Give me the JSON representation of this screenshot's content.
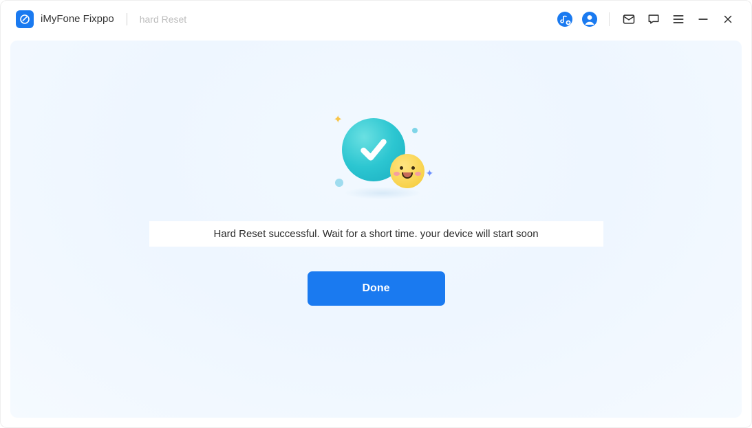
{
  "app": {
    "title": "iMyFone Fixppo",
    "breadcrumb": "hard Reset"
  },
  "main": {
    "message": "Hard Reset successful. Wait for a short time. your device will start soon",
    "done_label": "Done"
  },
  "icons": {
    "music": "music-note-icon",
    "account": "account-icon",
    "mail": "mail-icon",
    "chat": "chat-icon",
    "menu": "menu-icon",
    "minimize": "minimize-icon",
    "close": "close-icon"
  },
  "colors": {
    "accent": "#1a7af0",
    "success_circle": "#2cc6d1"
  }
}
